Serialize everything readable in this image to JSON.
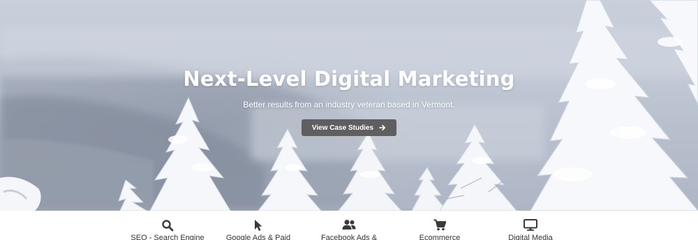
{
  "hero": {
    "title": "Next-Level Digital Marketing",
    "subtitle": "Better results from an industry veteran based in Vermont.",
    "cta_label": "View Case Studies",
    "cta_icon": "arrow-right-icon"
  },
  "services": [
    {
      "label": "SEO - Search Engine",
      "icon": "search-icon"
    },
    {
      "label": "Google Ads & Paid",
      "icon": "cursor-pointer-icon"
    },
    {
      "label": "Facebook Ads &",
      "icon": "users-icon"
    },
    {
      "label": "Ecommerce",
      "icon": "shopping-cart-icon"
    },
    {
      "label": "Digital Media",
      "icon": "monitor-icon"
    }
  ],
  "colors": {
    "cta_background": "#5f5f5f",
    "hero_text": "#ffffff",
    "icon": "#3a3a3a",
    "label_text": "#333333"
  }
}
